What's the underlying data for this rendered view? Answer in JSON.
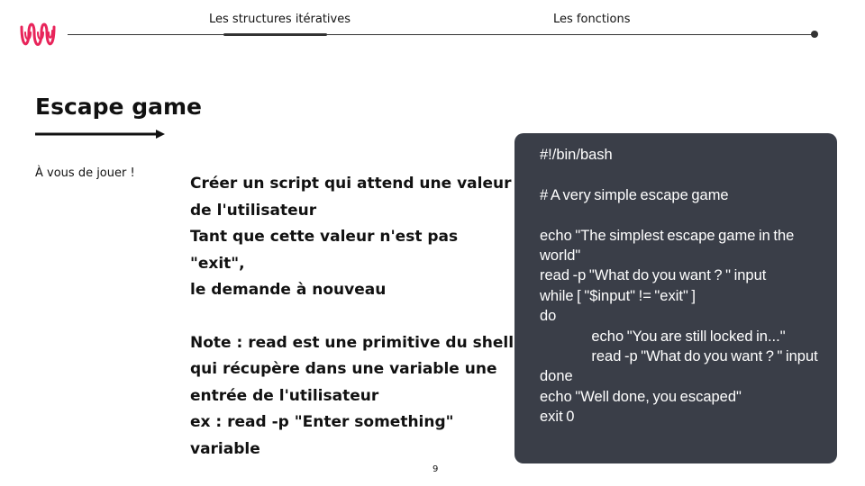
{
  "header": {
    "nav_items": [
      "Les structures itératives",
      "Les fonctions"
    ]
  },
  "slide": {
    "title": "Escape game",
    "subtitle": "À vous de jouer !",
    "instructions": [
      "Créer un script qui attend une valeur\nde l'utilisateur",
      "Tant que cette valeur n'est pas \"exit\",\nle demande à nouveau",
      "Note : read est une primitive du shell\nqui récupère dans une variable une\nentrée de l'utilisateur",
      "ex : read -p \"Enter something\"\nvariable"
    ],
    "code": "#!/bin/bash\n\n# A very simple escape game\n\necho \"The simplest escape game in the world\"\nread -p \"What do you want ? \" input\nwhile [ \"$input\" != \"exit\" ]\ndo\n\t\techo \"You are still locked in...\"\n\t\tread -p \"What do you want ? \" input\ndone\necho \"Well done, you escaped\"\nexit 0",
    "page_number": "9"
  },
  "colors": {
    "accent": "#e8245a",
    "code_background": "#3a3e48",
    "text": "#111111"
  }
}
